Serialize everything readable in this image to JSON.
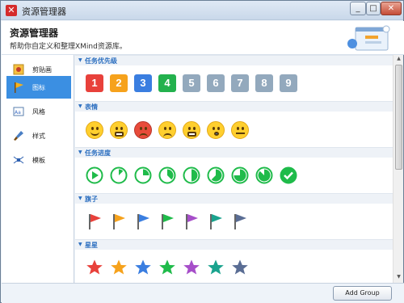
{
  "window": {
    "title": "资源管理器",
    "app_icon": "x-logo-icon",
    "min": "_",
    "max": "□",
    "close": "✕"
  },
  "header": {
    "title": "资源管理器",
    "subtitle": "帮助你自定义和整理XMind资源库。"
  },
  "sidebar": {
    "items": [
      {
        "label": "剪贴画",
        "icon": "clipart-icon"
      },
      {
        "label": "图标",
        "icon": "flag-icon",
        "active": true
      },
      {
        "label": "风格",
        "icon": "style-icon"
      },
      {
        "label": "样式",
        "icon": "brush-icon"
      },
      {
        "label": "模板",
        "icon": "template-icon"
      }
    ]
  },
  "sections": [
    {
      "title": "任务优先级",
      "numbers": [
        "1",
        "2",
        "3",
        "4",
        "5",
        "6",
        "7",
        "8",
        "9"
      ],
      "colors": [
        "#e8413b",
        "#f6a21c",
        "#3a7ee0",
        "#23b14d",
        "#93a9bd",
        "#93a9bd",
        "#93a9bd",
        "#93a9bd",
        "#93a9bd"
      ]
    },
    {
      "title": "表情"
    },
    {
      "title": "任务进度",
      "color": "#1fbb4a"
    },
    {
      "title": "旗子",
      "colors": [
        "#e8413b",
        "#f6a21c",
        "#3a7ee0",
        "#1fbb4a",
        "#a64ec9",
        "#1aa38e",
        "#5a6d94"
      ]
    },
    {
      "title": "星星",
      "colors": [
        "#e8413b",
        "#f6a21c",
        "#3a7ee0",
        "#1fbb4a",
        "#a64ec9",
        "#1aa38e",
        "#5a6d94"
      ]
    }
  ],
  "footer": {
    "add_group": "Add Group"
  }
}
